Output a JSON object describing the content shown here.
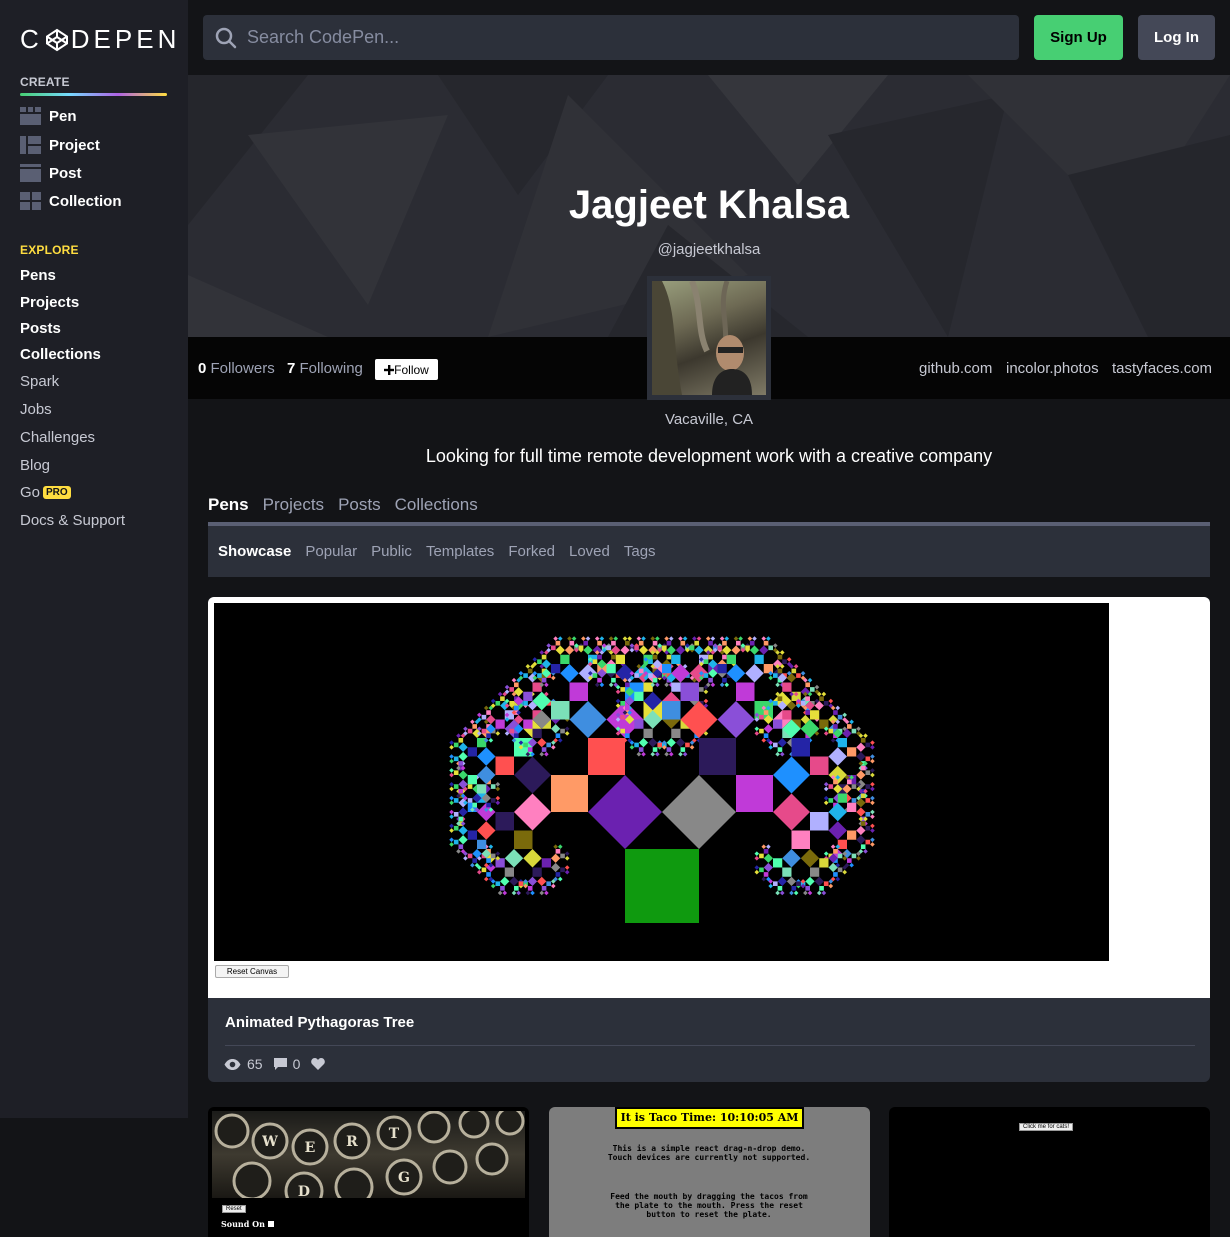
{
  "brand": {
    "logo_text_left": "C",
    "logo_text_right": "DEPEN"
  },
  "sidebar": {
    "create_heading": "CREATE",
    "create_items": [
      {
        "label": "Pen",
        "icon": "pen-icon"
      },
      {
        "label": "Project",
        "icon": "project-icon"
      },
      {
        "label": "Post",
        "icon": "post-icon"
      },
      {
        "label": "Collection",
        "icon": "collection-icon"
      }
    ],
    "explore_heading": "EXPLORE",
    "explore_items": [
      {
        "label": "Pens"
      },
      {
        "label": "Projects"
      },
      {
        "label": "Posts"
      },
      {
        "label": "Collections"
      },
      {
        "label": "Spark"
      },
      {
        "label": "Jobs"
      },
      {
        "label": "Challenges"
      },
      {
        "label": "Blog"
      },
      {
        "label": "Go",
        "badge": "PRO"
      },
      {
        "label": "Docs & Support"
      }
    ]
  },
  "header": {
    "search_placeholder": "Search CodePen...",
    "signup_label": "Sign Up",
    "login_label": "Log In"
  },
  "profile": {
    "name": "Jagjeet Khalsa",
    "handle": "@jagjeetkhalsa",
    "followers_count": "0",
    "followers_label": "Followers",
    "following_count": "7",
    "following_label": "Following",
    "follow_button": "Follow",
    "links": [
      "github.com",
      "incolor.photos",
      "tastyfaces.com"
    ],
    "location": "Vacaville, CA",
    "bio": "Looking for full time remote development work with a creative company"
  },
  "tabs": [
    "Pens",
    "Projects",
    "Posts",
    "Collections"
  ],
  "active_tab": "Pens",
  "subtabs": [
    "Showcase",
    "Popular",
    "Public",
    "Templates",
    "Forked",
    "Loved",
    "Tags"
  ],
  "active_subtab": "Showcase",
  "featured": {
    "reset_button": "Reset Canvas",
    "title": "Animated Pythagoras Tree",
    "views": "65",
    "comments": "0"
  },
  "cards": {
    "card1": {
      "button": "Reset",
      "sound_label": "Sound On"
    },
    "card2": {
      "title": "It is Taco Time: 10:10:05 AM",
      "line1": "This is a simple react drag-n-drop demo. Touch devices are currently not supported.",
      "line2": "Feed the mouth by dragging the tacos from the plate to the mouth. Press the reset button to reset the plate."
    },
    "card3": {
      "button": "Click me for cats!"
    }
  },
  "colors": {
    "accent_green": "#47cf73",
    "pro_yellow": "#ffdd40",
    "sidebar_bg": "#1e1f26",
    "card_bg": "#2c303a"
  }
}
